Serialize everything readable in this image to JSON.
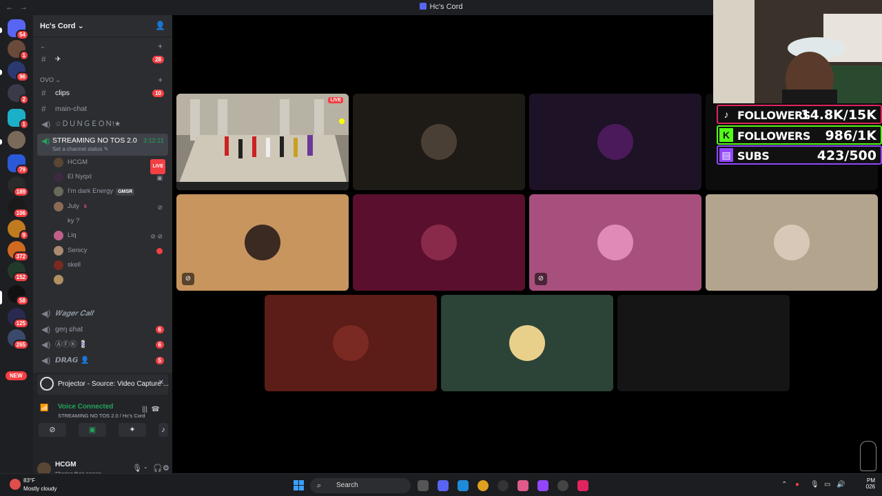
{
  "window": {
    "title": "Hc's Cord"
  },
  "servers": {
    "badges": [
      "54",
      "1",
      "96",
      "2",
      "1",
      "",
      "79",
      "189",
      "106",
      "9",
      "372",
      "152",
      "58",
      "125",
      "265"
    ],
    "new_label": "NEW"
  },
  "guild": {
    "name": "Hc's Cord ⌄",
    "top_category": "⌄",
    "top_channel": {
      "glyph": "#",
      "name": "✈",
      "count": "28"
    },
    "category_ovo": "OVO ⌄",
    "channels": [
      {
        "name": "clips",
        "count": "10",
        "bright": true,
        "glyph": "#"
      },
      {
        "name": "main-chat",
        "count": "",
        "bright": false,
        "glyph": "#"
      },
      {
        "name": "☆ＤＵＮＧＥＯＮ!★",
        "count": "",
        "bright": false,
        "glyph": "🔊"
      }
    ],
    "stream_channel": {
      "name": "STREAMING NO TOS 2.0",
      "status": "Set a channel status ✎",
      "timer": "3:12:21"
    },
    "voice_users": [
      {
        "name": "HCGM",
        "badge": "LIVE",
        "color": "#5a4634"
      },
      {
        "name": "El Nyqxl",
        "badge": "",
        "color": "#3b2a40"
      },
      {
        "name": "I'm dark Energy",
        "badge": "GMSR",
        "color": "#6a6a5a"
      },
      {
        "name": "July",
        "badge": "5",
        "color": "#8a6a55"
      },
      {
        "name": "ky ?",
        "badge": "",
        "color": "#2b2d31"
      },
      {
        "name": "Liq",
        "badge": "",
        "color": "#c0608a"
      },
      {
        "name": "Senicy",
        "badge": "",
        "color": "#aa8a70"
      },
      {
        "name": "skell",
        "badge": "",
        "color": "#7a2a20"
      },
      {
        "name": "",
        "badge": "",
        "color": "#b09060"
      }
    ],
    "lower_channels": [
      {
        "name": "𝑾𝒂𝒈𝒆𝒓 𝑪𝒂𝒍𝒍",
        "count": ""
      },
      {
        "name": "ɡeŋ ɕhat",
        "count": "6"
      },
      {
        "name": "ⒶⒻⓀ 💈",
        "count": "6"
      },
      {
        "name": "𝘿𝙍𝘼𝙂 👤",
        "count": "5"
      }
    ]
  },
  "panel": {
    "projector": "Projector - Source: Video Capture ...",
    "voice_status": "Voice Connected",
    "voice_location": "STREAMING NO TOS 2.0 / Hc's Cord",
    "user_name": "HCGM",
    "user_status": "Sharing their screen"
  },
  "stage": {
    "live_label": "LIVE",
    "tiles_row1_colors": [
      "#1e1a16",
      "#1e1226",
      "#0d0d0d"
    ],
    "tiles_row2_colors": [
      "#c8955e",
      "#5a0f2e",
      "#a8507d",
      "#b3a48d"
    ],
    "tiles_row3_colors": [
      "#5c1c18",
      "#2c4338",
      "#151515"
    ]
  },
  "overlay": {
    "followers_tiktok_label": "FOLLOWERS",
    "followers_tiktok_value": "14.8K/15K",
    "followers_kick_label": "FOLLOWERS",
    "followers_kick_value": "986/1K",
    "subs_label": "SUBS",
    "subs_value": "423/500",
    "colors": {
      "tiktok": "#e0245e",
      "kick": "#53fc18",
      "twitch": "#9146ff"
    }
  },
  "taskbar": {
    "temp": "83°F",
    "condition": "Mostly cloudy",
    "search_placeholder": "Search",
    "time": "PM",
    "date": "026"
  }
}
